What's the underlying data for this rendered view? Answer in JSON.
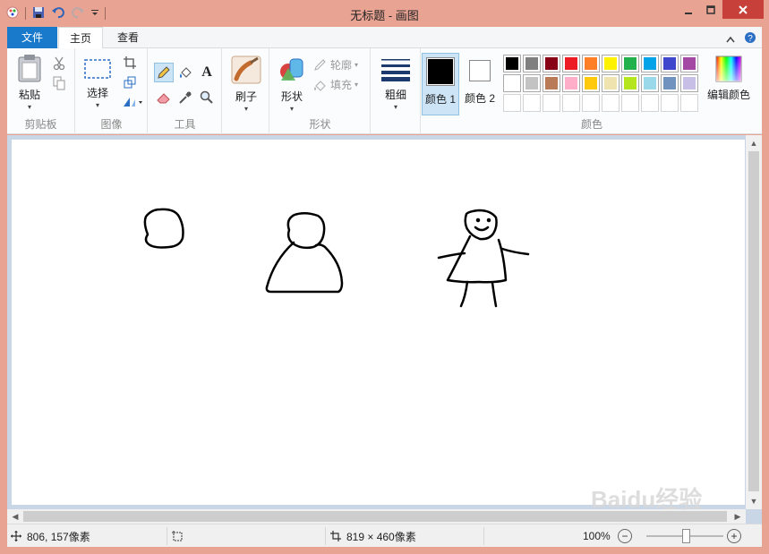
{
  "window": {
    "title": "无标题 - 画图"
  },
  "tabs": {
    "file": "文件",
    "home": "主页",
    "view": "查看"
  },
  "ribbon": {
    "clipboard": {
      "paste": "粘贴",
      "label": "剪贴板"
    },
    "image": {
      "select": "选择",
      "label": "图像"
    },
    "tools": {
      "label": "工具",
      "text_tool": "A"
    },
    "brushes": {
      "label": "刷子"
    },
    "shapes": {
      "label": "形状",
      "group_label": "形状",
      "outline": "轮廓",
      "fill": "填充"
    },
    "size": {
      "label": "粗细"
    },
    "colors": {
      "color1": "颜色 1",
      "color2": "颜色 2",
      "edit_colors": "编辑颜色",
      "group_label": "颜色",
      "color1_value": "#000000",
      "color2_value": "#ffffff",
      "palette_row1": [
        "#000000",
        "#7f7f7f",
        "#880015",
        "#ed1c24",
        "#ff7f27",
        "#fff200",
        "#22b14c",
        "#00a2e8",
        "#3f48cc",
        "#a349a4"
      ],
      "palette_row2": [
        "#ffffff",
        "#c3c3c3",
        "#b97a57",
        "#ffaec9",
        "#ffc90e",
        "#efe4b0",
        "#b5e61d",
        "#99d9ea",
        "#7092be",
        "#c8bfe7"
      ]
    }
  },
  "statusbar": {
    "cursor_pos": "806, 157像素",
    "canvas_size": "819 × 460像素",
    "zoom": "100%"
  },
  "watermark": "Baidu经验"
}
